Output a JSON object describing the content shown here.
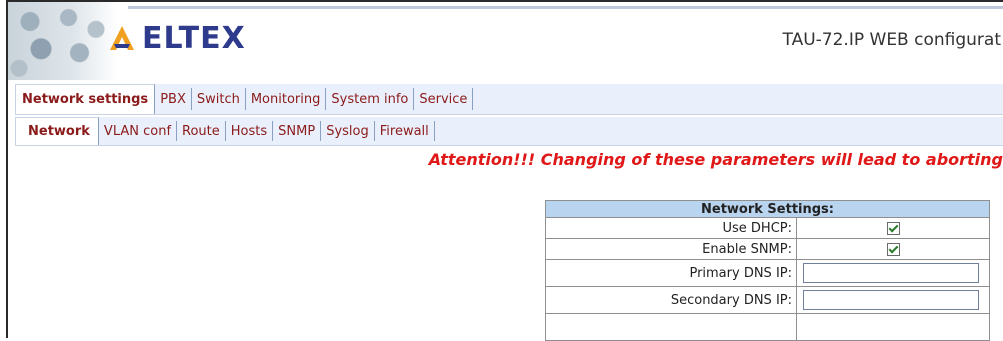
{
  "header": {
    "logo_text": "ELTEX",
    "title": "TAU-72.IP WEB configurat"
  },
  "main_tabs": [
    {
      "label": "Network settings",
      "active": true
    },
    {
      "label": "PBX",
      "active": false
    },
    {
      "label": "Switch",
      "active": false
    },
    {
      "label": "Monitoring",
      "active": false
    },
    {
      "label": "System info",
      "active": false
    },
    {
      "label": "Service",
      "active": false
    }
  ],
  "sub_tabs": [
    {
      "label": "Network",
      "active": true
    },
    {
      "label": "VLAN conf",
      "active": false
    },
    {
      "label": "Route",
      "active": false
    },
    {
      "label": "Hosts",
      "active": false
    },
    {
      "label": "SNMP",
      "active": false
    },
    {
      "label": "Syslog",
      "active": false
    },
    {
      "label": "Firewall",
      "active": false
    }
  ],
  "attention_text": "Attention!!! Changing of these parameters will lead to aborting",
  "settings": {
    "header": "Network Settings:",
    "rows": [
      {
        "label": "Use DHCP:",
        "type": "checkbox",
        "checked": true
      },
      {
        "label": "Enable SNMP:",
        "type": "checkbox",
        "checked": true
      },
      {
        "label": "Primary DNS IP:",
        "type": "text",
        "value": ""
      },
      {
        "label": "Secondary DNS IP:",
        "type": "text",
        "value": ""
      }
    ]
  },
  "colors": {
    "accent_red": "#e01818",
    "tab_text": "#8b1a1a",
    "table_header_bg": "#b9d4ee",
    "logo_blue": "#2e3a8c"
  }
}
